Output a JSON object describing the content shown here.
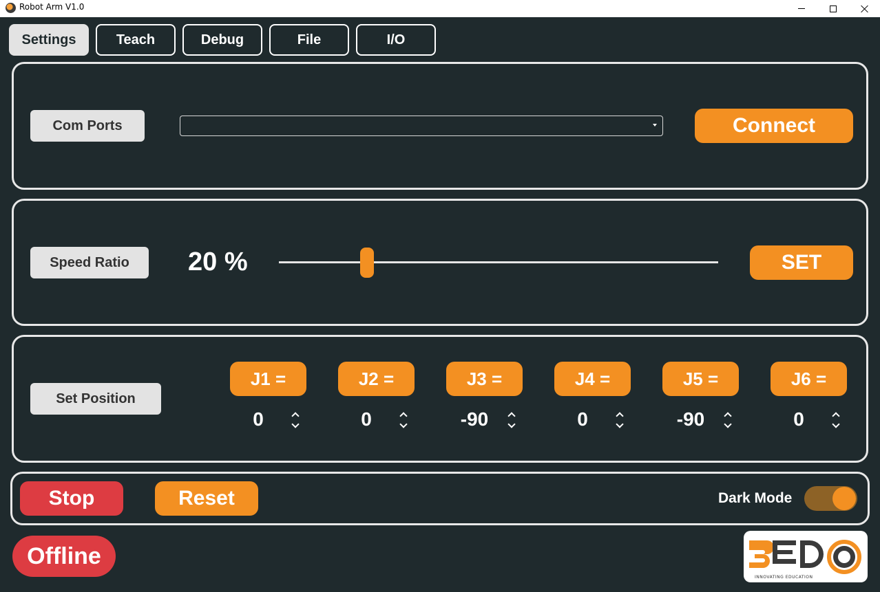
{
  "window": {
    "title": "Robot Arm V1.0"
  },
  "tabs": [
    {
      "label": "Settings",
      "active": true
    },
    {
      "label": "Teach"
    },
    {
      "label": "Debug"
    },
    {
      "label": "File"
    },
    {
      "label": "I/O"
    }
  ],
  "com": {
    "label": "Com Ports",
    "selected": "",
    "connect_label": "Connect"
  },
  "speed": {
    "label": "Speed Ratio",
    "value_text": "20 %",
    "value_percent": 20,
    "set_label": "SET"
  },
  "position": {
    "label": "Set Position",
    "joints": [
      {
        "label": "J1 =",
        "value": "0"
      },
      {
        "label": "J2 =",
        "value": "0"
      },
      {
        "label": "J3 =",
        "value": "-90"
      },
      {
        "label": "J4 =",
        "value": "0"
      },
      {
        "label": "J5 =",
        "value": "-90"
      },
      {
        "label": "J6 =",
        "value": "0"
      }
    ]
  },
  "controls": {
    "stop_label": "Stop",
    "reset_label": "Reset",
    "dark_mode_label": "Dark Mode",
    "dark_mode_on": true
  },
  "status": {
    "connection": "Offline"
  },
  "logo": {
    "brand": "BEDO",
    "tagline": "INNOVATING EDUCATION"
  },
  "colors": {
    "background": "#1f2a2d",
    "accent": "#f39022",
    "danger": "#dd3c42",
    "panel_border": "#e8e8e8"
  }
}
